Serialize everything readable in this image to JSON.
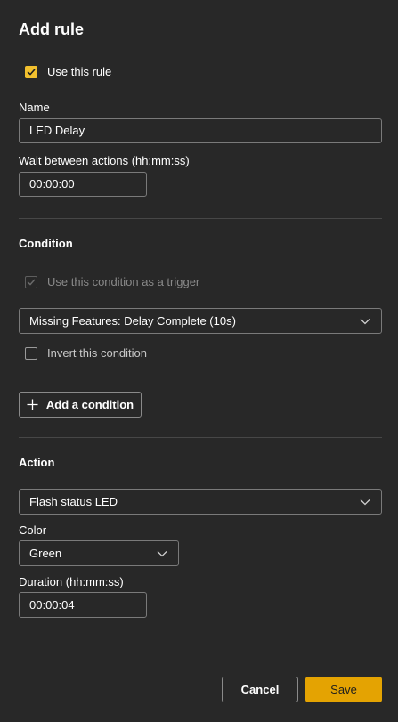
{
  "panel": {
    "title": "Add rule"
  },
  "use_rule": {
    "label": "Use this rule",
    "checked": true
  },
  "name": {
    "label": "Name",
    "value": "LED Delay"
  },
  "wait": {
    "label": "Wait between actions (hh:mm:ss)",
    "value": "00:00:00"
  },
  "condition": {
    "heading": "Condition",
    "trigger_label": "Use this condition as a trigger",
    "trigger_checked": true,
    "trigger_disabled": true,
    "selected": "Missing Features: Delay Complete (10s)",
    "invert_label": "Invert this condition",
    "invert_checked": false,
    "add_label": "Add a condition"
  },
  "action": {
    "heading": "Action",
    "selected": "Flash status LED",
    "color_label": "Color",
    "color_value": "Green",
    "duration_label": "Duration (hh:mm:ss)",
    "duration_value": "00:00:04"
  },
  "footer": {
    "cancel_label": "Cancel",
    "save_label": "Save"
  },
  "colors": {
    "accent": "#f2c02e",
    "save_button": "#e4a302",
    "background": "#282828"
  },
  "icons": [
    "checkmark-icon",
    "chevron-down-icon",
    "plus-icon"
  ]
}
